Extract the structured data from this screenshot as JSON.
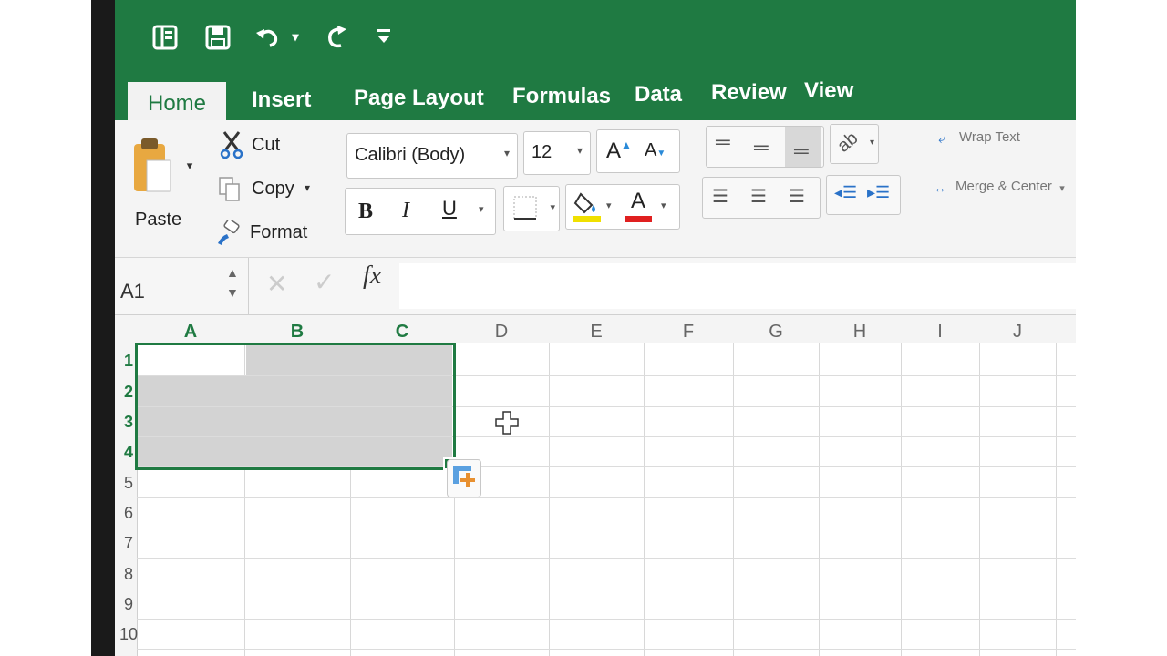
{
  "quick_access": {
    "icons": [
      "sidebar-icon",
      "save-icon",
      "undo-icon",
      "redo-icon",
      "customize-icon"
    ]
  },
  "tabs": [
    "Home",
    "Insert",
    "Page Layout",
    "Formulas",
    "Data",
    "Review",
    "View"
  ],
  "clipboard": {
    "paste": "Paste",
    "cut": "Cut",
    "copy": "Copy",
    "format": "Format"
  },
  "font": {
    "family": "Calibri (Body)",
    "size": "12",
    "increase": "A",
    "decrease": "A",
    "bold": "B",
    "italic": "I",
    "underline": "U",
    "font_color": "A"
  },
  "alignment": {
    "wrap_text": "Wrap Text",
    "merge_center": "Merge & Center"
  },
  "formula_bar": {
    "name_box": "A1",
    "fx": "fx",
    "cancel": "✕",
    "enter": "✓"
  },
  "sheet": {
    "columns": [
      "A",
      "B",
      "C",
      "D",
      "E",
      "F",
      "G",
      "H",
      "I",
      "J"
    ],
    "rows": [
      "1",
      "2",
      "3",
      "4",
      "5",
      "6",
      "7",
      "8",
      "9",
      "10"
    ],
    "selected_range": "A1:C4"
  },
  "colors": {
    "accent_green": "#1f7a42",
    "highlight_yellow": "#f0e000",
    "font_red": "#e02020"
  }
}
